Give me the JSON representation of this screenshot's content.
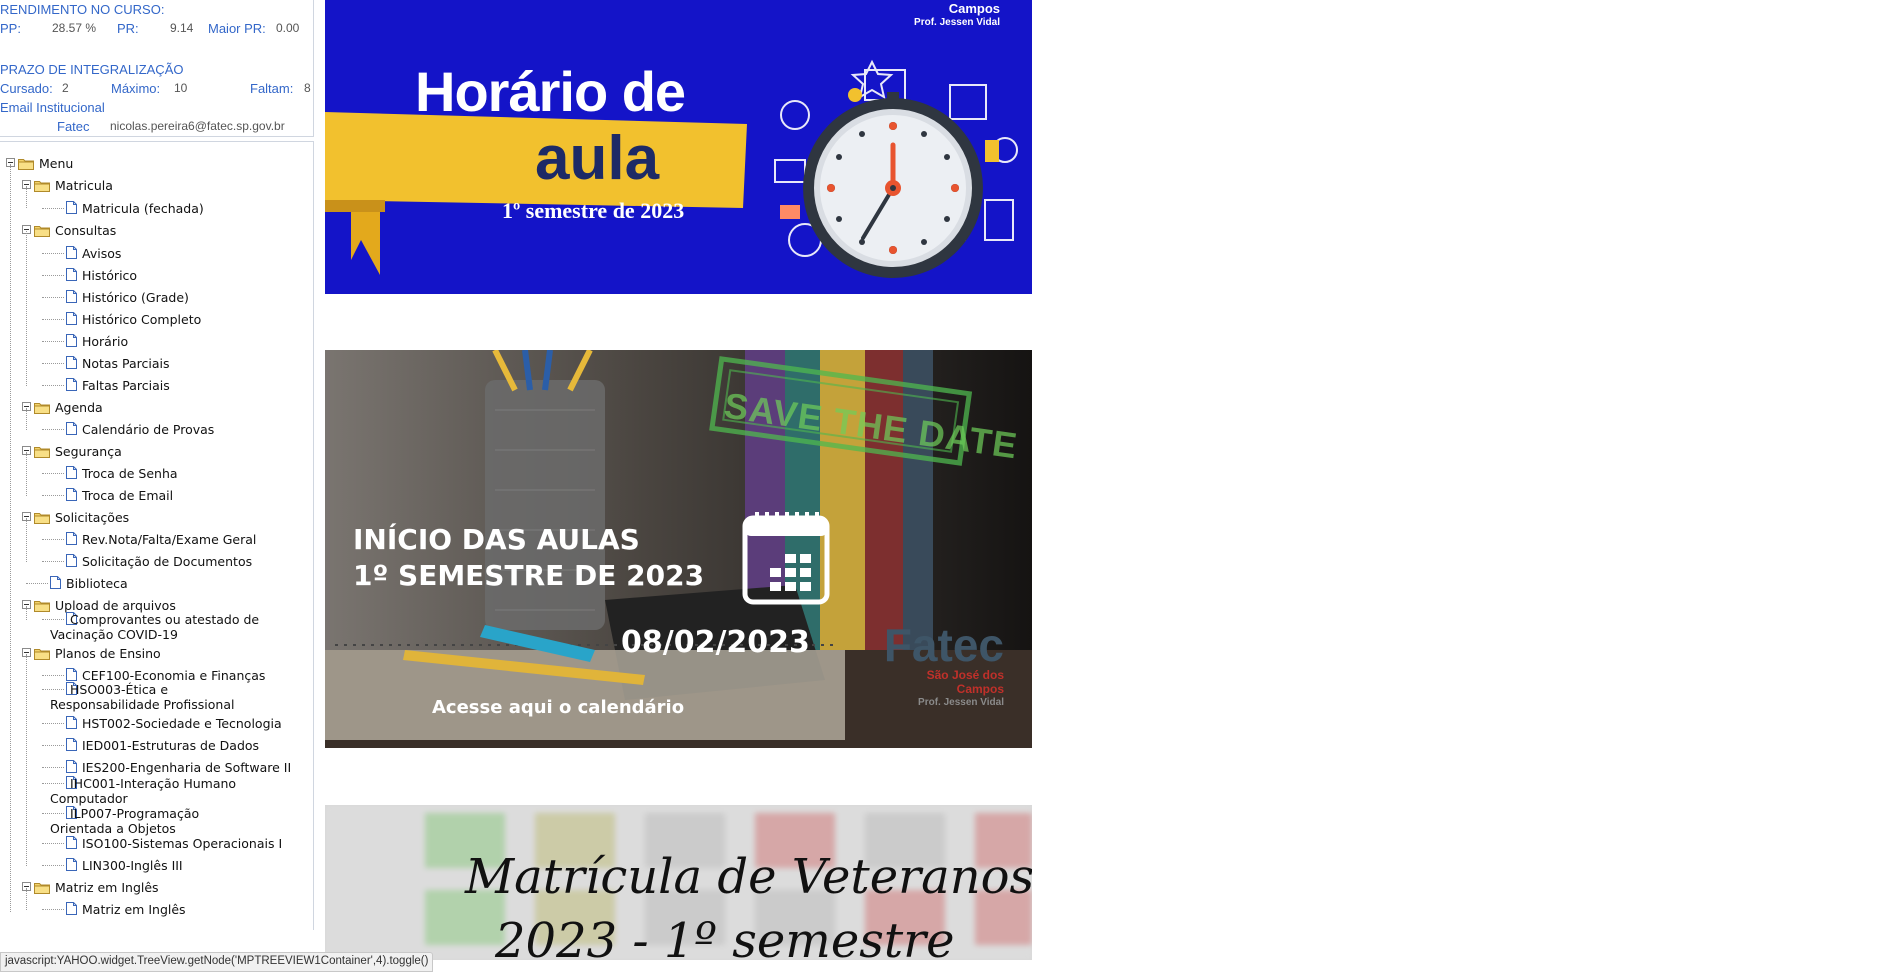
{
  "info": {
    "rendimento_title": "RENDIMENTO NO CURSO:",
    "pp_label": "PP:",
    "pp_value": "28.57 %",
    "pr_label": "PR:",
    "pr_value": "9.14",
    "maior_pr_label": "Maior PR:",
    "maior_pr_value": "0.00",
    "prazo_title": "PRAZO DE INTEGRALIZAÇÃO",
    "cursado_label": "Cursado:",
    "cursado_value": "2",
    "maximo_label": "Máximo:",
    "maximo_value": "10",
    "faltam_label": "Faltam:",
    "faltam_value": "8",
    "email_title": "Email Institucional",
    "fatec_label": "Fatec",
    "email_value": "nicolas.pereira6@fatec.sp.gov.br"
  },
  "menu": {
    "root": "Menu",
    "matricula": {
      "label": "Matricula",
      "items": [
        "Matricula (fechada)"
      ]
    },
    "consultas": {
      "label": "Consultas",
      "items": [
        "Avisos",
        "Histórico",
        "Histórico (Grade)",
        "Histórico Completo",
        "Horário",
        "Notas Parciais",
        "Faltas Parciais"
      ]
    },
    "agenda": {
      "label": "Agenda",
      "items": [
        "Calendário de Provas"
      ]
    },
    "seguranca": {
      "label": "Segurança",
      "items": [
        "Troca de Senha",
        "Troca de Email"
      ]
    },
    "solicitacoes": {
      "label": "Solicitações",
      "items": [
        "Rev.Nota/Falta/Exame Geral",
        "Solicitação de Documentos"
      ]
    },
    "biblioteca": "Biblioteca",
    "upload": {
      "label": "Upload de arquivos",
      "items": [
        "Comprovantes ou atestado de Vacinação COVID-19"
      ]
    },
    "planos": {
      "label": "Planos de Ensino",
      "items": [
        "CEF100-Economia e Finanças",
        "HSO003-Ética e Responsabilidade Profissional",
        "HST002-Sociedade e Tecnologia",
        "IED001-Estruturas de Dados",
        "IES200-Engenharia de Software II",
        "IHC001-Interação Humano Computador",
        "ILP007-Programação Orientada a Objetos",
        "ISO100-Sistemas Operacionais I",
        "LIN300-Inglês III"
      ]
    },
    "matriz": {
      "label": "Matriz em Inglês",
      "items": [
        "Matriz em Inglês"
      ]
    }
  },
  "banner1": {
    "top_line1": "Campos",
    "top_line2": "Prof. Jessen Vidal",
    "title_line1": "Horário de",
    "title_line2": "aula",
    "subtitle": "1º semestre de 2023",
    "colors": {
      "background": "#1414c8",
      "ribbon": "#f2c12e"
    }
  },
  "banner2": {
    "stamp": "SAVE THE DATE",
    "heading_line1": "INÍCIO DAS AULAS",
    "heading_line2": "1º SEMESTRE DE 2023",
    "date": "08/02/2023",
    "link": "Acesse aqui o calendário",
    "logo": "Fatec",
    "logo_sub1": "São José dos",
    "logo_sub2": "Campos",
    "logo_sub3": "Prof. Jessen Vidal"
  },
  "banner3": {
    "title_line1": "Matrícula de Veteranos",
    "title_line2": "2023 - 1º semestre"
  },
  "statusbar": "javascript:YAHOO.widget.TreeView.getNode('MPTREEVIEW1Container',4).toggle()"
}
